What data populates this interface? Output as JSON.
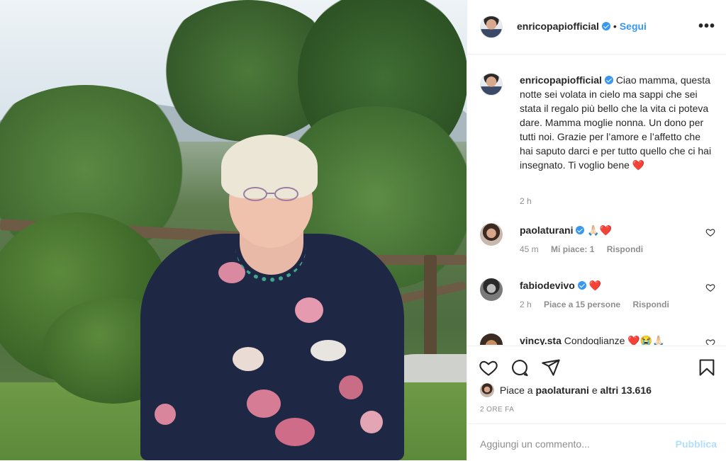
{
  "post": {
    "author": "enricopapiofficial",
    "follow_label": "Segui",
    "dot": "•",
    "more_label": "•••"
  },
  "caption": {
    "author": "enricopapiofficial",
    "text": "Ciao mamma, questa notte sei volata in cielo ma sappi che sei stata il regalo più bello che la vita ci poteva dare. Mamma moglie nonna. Un dono per tutti noi. Grazie per l’amore e l’affetto che hai saputo darci e per tutto quello che ci hai insegnato. Ti voglio bene ❤️",
    "time": "2 h"
  },
  "comments": [
    {
      "user": "paolaturani",
      "verified": true,
      "text": "🙏🏻❤️",
      "time": "45 m",
      "likes": "Mi piace: 1",
      "reply": "Rispondi"
    },
    {
      "user": "fabiodevivo",
      "verified": true,
      "text": "❤️",
      "time": "2 h",
      "likes": "Piace a 15 persone",
      "reply": "Rispondi"
    },
    {
      "user": "vincy.sta",
      "verified": false,
      "text": "Condoglianze ❤️😭🙏🏻",
      "time": "",
      "likes": "",
      "reply": ""
    }
  ],
  "actions": {
    "icons": [
      "heart-icon",
      "comment-icon",
      "share-icon",
      "bookmark-icon"
    ],
    "likes_prefix": "Piace a",
    "likes_user": "paolaturani",
    "likes_connector": "e",
    "likes_others": "altri 13.616",
    "timestamp": "2 ORE FA"
  },
  "add_comment": {
    "placeholder": "Aggiungi un commento...",
    "publish_label": "Pubblica"
  },
  "colors": {
    "accent": "#3897f0",
    "publish_disabled": "#b2dffc",
    "heart": "#ed4956",
    "text": "#262626",
    "muted": "#8e8e8e"
  }
}
